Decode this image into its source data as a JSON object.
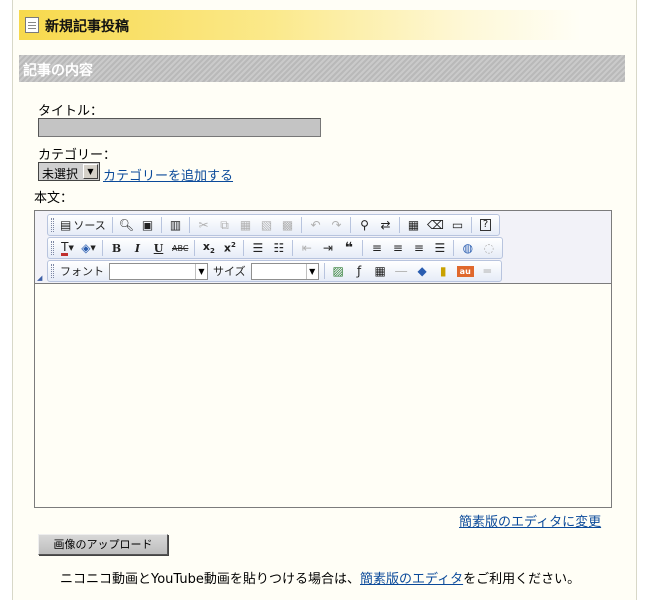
{
  "header": {
    "title": "新規記事投稿"
  },
  "section": {
    "title": "記事の内容"
  },
  "form": {
    "title_label": "タイトル：",
    "title_value": "",
    "category_label": "カテゴリー：",
    "category_selected": "未選択",
    "add_category_link": "カテゴリーを追加する",
    "body_label": "本文："
  },
  "toolbar": {
    "row1": [
      {
        "name": "source-button",
        "icon": "source-icon",
        "label": "ソース",
        "enabled": true
      },
      {
        "name": "preview-button",
        "icon": "preview-icon",
        "enabled": true
      },
      {
        "name": "save-button",
        "icon": "save-icon",
        "enabled": true
      },
      {
        "name": "templates-button",
        "icon": "templates-icon",
        "enabled": true
      },
      {
        "name": "cut-button",
        "icon": "cut-icon",
        "enabled": false
      },
      {
        "name": "copy-button",
        "icon": "copy-icon",
        "enabled": false
      },
      {
        "name": "paste-button",
        "icon": "paste-icon",
        "enabled": false
      },
      {
        "name": "paste-text-button",
        "icon": "paste-text-icon",
        "enabled": false
      },
      {
        "name": "paste-word-button",
        "icon": "paste-word-icon",
        "enabled": false
      },
      {
        "name": "undo-button",
        "icon": "undo-icon",
        "enabled": false
      },
      {
        "name": "redo-button",
        "icon": "redo-icon",
        "enabled": false
      },
      {
        "name": "find-button",
        "icon": "find-icon",
        "enabled": true
      },
      {
        "name": "replace-button",
        "icon": "replace-icon",
        "enabled": true
      },
      {
        "name": "select-all-button",
        "icon": "select-all-icon",
        "enabled": true
      },
      {
        "name": "remove-format-button",
        "icon": "eraser-icon",
        "enabled": true
      },
      {
        "name": "fit-window-button",
        "icon": "maximize-icon",
        "enabled": true
      },
      {
        "name": "about-button",
        "icon": "help-icon",
        "enabled": true
      }
    ],
    "row2": [
      {
        "name": "text-color-button",
        "icon": "text-color-icon",
        "enabled": true
      },
      {
        "name": "bg-color-button",
        "icon": "bg-color-icon",
        "enabled": true
      },
      {
        "name": "bold-button",
        "icon": "bold-icon",
        "enabled": true
      },
      {
        "name": "italic-button",
        "icon": "italic-icon",
        "enabled": true
      },
      {
        "name": "underline-button",
        "icon": "underline-icon",
        "enabled": true
      },
      {
        "name": "strike-button",
        "icon": "strikethrough-icon",
        "enabled": true
      },
      {
        "name": "subscript-button",
        "icon": "subscript-icon",
        "enabled": true
      },
      {
        "name": "superscript-button",
        "icon": "superscript-icon",
        "enabled": true
      },
      {
        "name": "ordered-list-button",
        "icon": "ordered-list-icon",
        "enabled": true
      },
      {
        "name": "unordered-list-button",
        "icon": "unordered-list-icon",
        "enabled": true
      },
      {
        "name": "outdent-button",
        "icon": "outdent-icon",
        "enabled": false
      },
      {
        "name": "indent-button",
        "icon": "indent-icon",
        "enabled": true
      },
      {
        "name": "blockquote-button",
        "icon": "blockquote-icon",
        "enabled": true
      },
      {
        "name": "align-left-button",
        "icon": "align-left-icon",
        "enabled": true
      },
      {
        "name": "align-center-button",
        "icon": "align-center-icon",
        "enabled": true
      },
      {
        "name": "align-right-button",
        "icon": "align-right-icon",
        "enabled": true
      },
      {
        "name": "align-justify-button",
        "icon": "align-justify-icon",
        "enabled": true
      },
      {
        "name": "link-button",
        "icon": "link-icon",
        "enabled": true
      },
      {
        "name": "unlink-button",
        "icon": "unlink-icon",
        "enabled": false
      }
    ],
    "row3": {
      "font_label": "フォント",
      "font_value": "",
      "size_label": "サイズ",
      "size_value": "",
      "buttons": [
        {
          "name": "image-button",
          "icon": "image-icon",
          "enabled": true
        },
        {
          "name": "flash-button",
          "icon": "flash-icon",
          "enabled": true
        },
        {
          "name": "table-button",
          "icon": "table-icon",
          "enabled": true
        },
        {
          "name": "horizontal-rule-button",
          "icon": "horizontal-rule-icon",
          "enabled": false
        },
        {
          "name": "special-char-button",
          "icon": "special-char-icon",
          "enabled": true
        },
        {
          "name": "page-break-button",
          "icon": "page-break-icon",
          "enabled": true
        },
        {
          "name": "au-button",
          "icon": "au-icon",
          "label": "au",
          "enabled": true
        },
        {
          "name": "more-button",
          "icon": "more-icon",
          "enabled": false
        }
      ]
    }
  },
  "links": {
    "simple_editor_switch": "簡素版のエディタに変更"
  },
  "upload": {
    "label": "画像のアップロード"
  },
  "note": {
    "prefix": "ニコニコ動画とYouTube動画を貼りつける場合は、",
    "link": "簡素版のエディタ",
    "suffix": "をご利用ください。"
  },
  "colors": {
    "title_bar": "#f7d94c",
    "section_bar": "#bfbfbf",
    "link": "#0b4a9a",
    "page_bg": "#fffef6"
  }
}
